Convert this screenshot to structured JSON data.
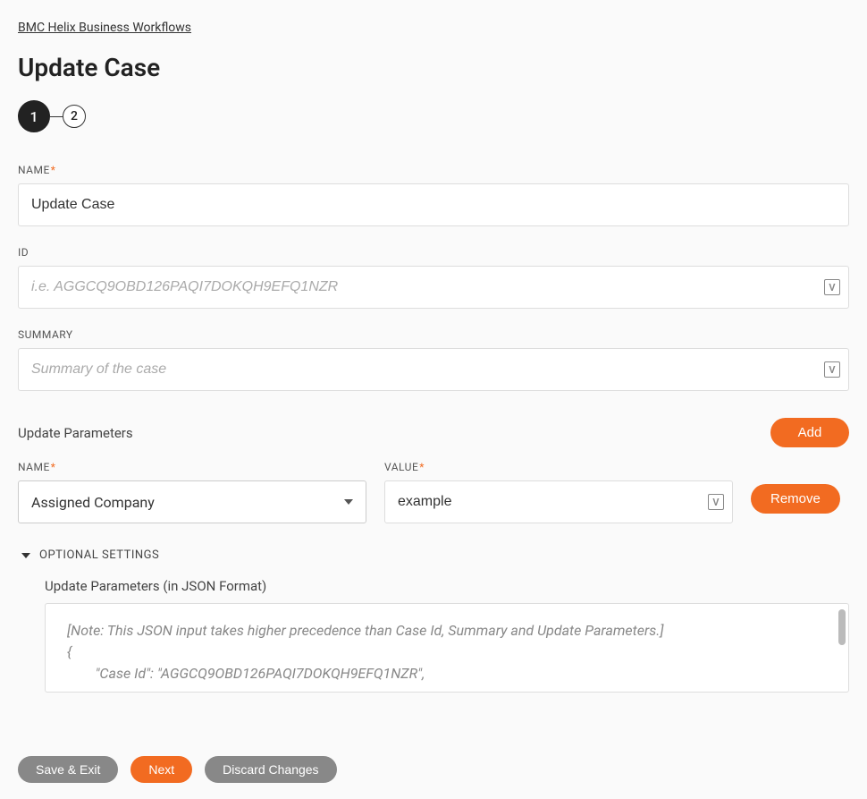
{
  "breadcrumb": "BMC Helix Business Workflows",
  "page_title": "Update Case",
  "wizard": {
    "step1": "1",
    "step2": "2"
  },
  "fields": {
    "name": {
      "label": "NAME",
      "value": "Update Case"
    },
    "id": {
      "label": "ID",
      "placeholder": "i.e. AGGCQ9OBD126PAQI7DOKQH9EFQ1NZR"
    },
    "summary": {
      "label": "SUMMARY",
      "placeholder": "Summary of the case"
    }
  },
  "update_params": {
    "section_label": "Update Parameters",
    "add_label": "Add",
    "name_label": "NAME",
    "value_label": "VALUE",
    "remove_label": "Remove",
    "row": {
      "name": "Assigned Company",
      "value": "example"
    }
  },
  "optional": {
    "toggle_label": "OPTIONAL SETTINGS",
    "json_label": "Update Parameters (in JSON Format)",
    "json_placeholder": "[Note: This JSON input takes higher precedence than Case Id, Summary and Update Parameters.]\n{\n        \"Case Id\": \"AGGCQ9OBD126PAQI7DOKQH9EFQ1NZR\","
  },
  "footer": {
    "save_exit": "Save & Exit",
    "next": "Next",
    "discard": "Discard Changes"
  },
  "icons": {
    "variable": "V"
  }
}
